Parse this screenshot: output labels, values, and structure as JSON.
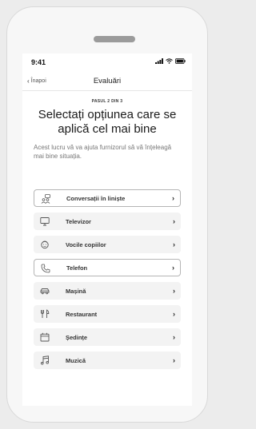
{
  "status": {
    "time": "9:41"
  },
  "nav": {
    "back_label": "Înapoi",
    "title": "Evaluări"
  },
  "step_label": "PASUL 2 DIN 3",
  "heading": "Selectați opțiunea care se aplică cel mai bine",
  "description": "Acest lucru vă va ajuta furnizorul să vă înțeleagă mai bine situația.",
  "options": [
    {
      "label": "Conversații în liniște",
      "icon": "people-conversation-icon",
      "selected": true
    },
    {
      "label": "Televizor",
      "icon": "tv-icon",
      "selected": false
    },
    {
      "label": "Vocile copiilor",
      "icon": "child-icon",
      "selected": false
    },
    {
      "label": "Telefon",
      "icon": "phone-icon",
      "selected": true
    },
    {
      "label": "Mașină",
      "icon": "car-icon",
      "selected": false
    },
    {
      "label": "Restaurant",
      "icon": "fork-knife-icon",
      "selected": false
    },
    {
      "label": "Ședințe",
      "icon": "calendar-icon",
      "selected": false
    },
    {
      "label": "Muzică",
      "icon": "music-note-icon",
      "selected": false
    }
  ]
}
